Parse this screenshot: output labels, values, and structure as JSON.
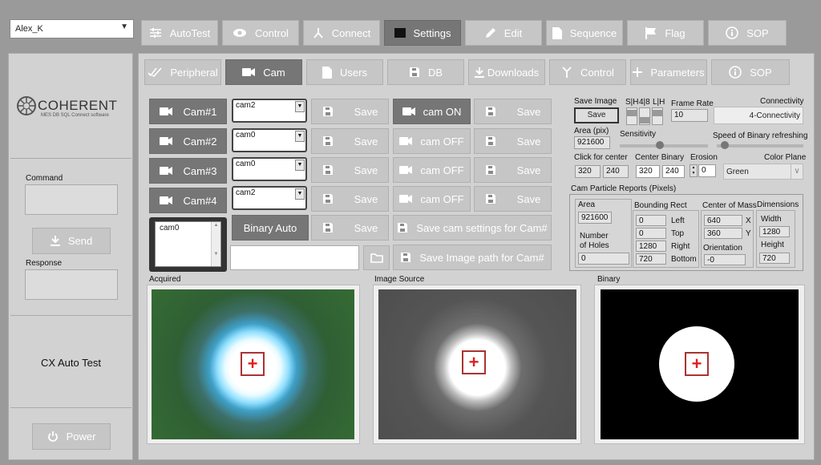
{
  "user_select": {
    "value": "Alex_K"
  },
  "top_tabs": [
    {
      "label": "AutoTest",
      "icon": "sliders-icon"
    },
    {
      "label": "Control",
      "icon": "eye-icon"
    },
    {
      "label": "Connect",
      "icon": "merge-icon"
    },
    {
      "label": "Settings",
      "icon": "square-icon"
    },
    {
      "label": "Edit",
      "icon": "pencil-icon"
    },
    {
      "label": "Sequence",
      "icon": "file-icon"
    },
    {
      "label": "Flag",
      "icon": "flag-icon"
    },
    {
      "label": "SOP",
      "icon": "info-icon"
    }
  ],
  "sub_tabs": [
    {
      "label": "Peripheral",
      "icon": "checkmarks-icon"
    },
    {
      "label": "Cam",
      "icon": "camera-icon"
    },
    {
      "label": "Users",
      "icon": "file-icon"
    },
    {
      "label": "DB",
      "icon": "save-icon"
    },
    {
      "label": "Downloads",
      "icon": "download-icon"
    },
    {
      "label": "Control",
      "icon": "fork-icon"
    },
    {
      "label": "Parameters",
      "icon": "plus-icon"
    },
    {
      "label": "SOP",
      "icon": "info-icon"
    }
  ],
  "sidebar": {
    "logo_text": "COHERENT",
    "logo_sub": "MES DB SQL Connect software",
    "command_label": "Command",
    "send_label": "Send",
    "response_label": "Response",
    "auto_test_label": "CX Auto Test",
    "power_label": "Power"
  },
  "cams": [
    {
      "label": "Cam#1",
      "select": "cam2",
      "save": "Save",
      "state": "cam ON",
      "save2": "Save"
    },
    {
      "label": "Cam#2",
      "select": "cam0",
      "save": "Save",
      "state": "cam OFF",
      "save2": "Save"
    },
    {
      "label": "Cam#3",
      "select": "cam0",
      "save": "Save",
      "state": "cam OFF",
      "save2": "Save"
    },
    {
      "label": "Cam#4",
      "select": "cam2",
      "save": "Save",
      "state": "cam OFF",
      "save2": "Save"
    }
  ],
  "cam_list": {
    "value": "cam0"
  },
  "binary_auto": {
    "label": "Binary Auto",
    "save": "Save"
  },
  "save_cam_settings": "Save cam settings for Cam#",
  "save_image_path": "Save Image path for Cam#",
  "image_path": {
    "value": ""
  },
  "settings": {
    "save_image_label": "Save Image",
    "save_button": "Save",
    "slider_labels": [
      "S|H",
      "4|8",
      "L|H"
    ],
    "frame_rate_label": "Frame Rate",
    "frame_rate": "10",
    "connectivity_label": "Connectivity",
    "connectivity": "4-Connectivity",
    "area_label": "Area (pix)",
    "area": "921600",
    "sensitivity_label": "Sensitivity",
    "speed_label": "Speed of Binary refreshing",
    "sensitivity_level": 0.45,
    "speed_level": 0.05,
    "click_center_label": "Click for center",
    "click_center_x": "320",
    "click_center_y": "240",
    "center_binary_label": "Center Binary",
    "center_binary_x": "320",
    "center_binary_y": "240",
    "erosion_label": "Erosion",
    "erosion": "0",
    "color_plane_label": "Color Plane",
    "color_plane": "Green"
  },
  "reports": {
    "title": "Cam Particle Reports (Pixels)",
    "area_label": "Area",
    "area": "921600",
    "holes_label1": "Number",
    "holes_label2": "of Holes",
    "holes": "0",
    "bounding_label": "Bounding Rect",
    "left_label": "Left",
    "left": "0",
    "top_label": "Top",
    "top": "0",
    "right_label": "Right",
    "right": "1280",
    "bottom_label": "Bottom",
    "bottom": "720",
    "com_label": "Center of Mass",
    "com_x": "640",
    "com_y": "360",
    "x_label": "X",
    "y_label": "Y",
    "orientation_label": "Orientation",
    "orientation": "-0",
    "dimensions_label": "Dimensions",
    "width_label": "Width",
    "width": "1280",
    "height_label": "Height",
    "height": "720"
  },
  "images": [
    {
      "label": "Acquired"
    },
    {
      "label": "Image Source"
    },
    {
      "label": "Binary"
    }
  ],
  "colors": {
    "accent_red": "#cc3333",
    "dark_button": "#767676",
    "light_button": "#c6c6c6"
  }
}
